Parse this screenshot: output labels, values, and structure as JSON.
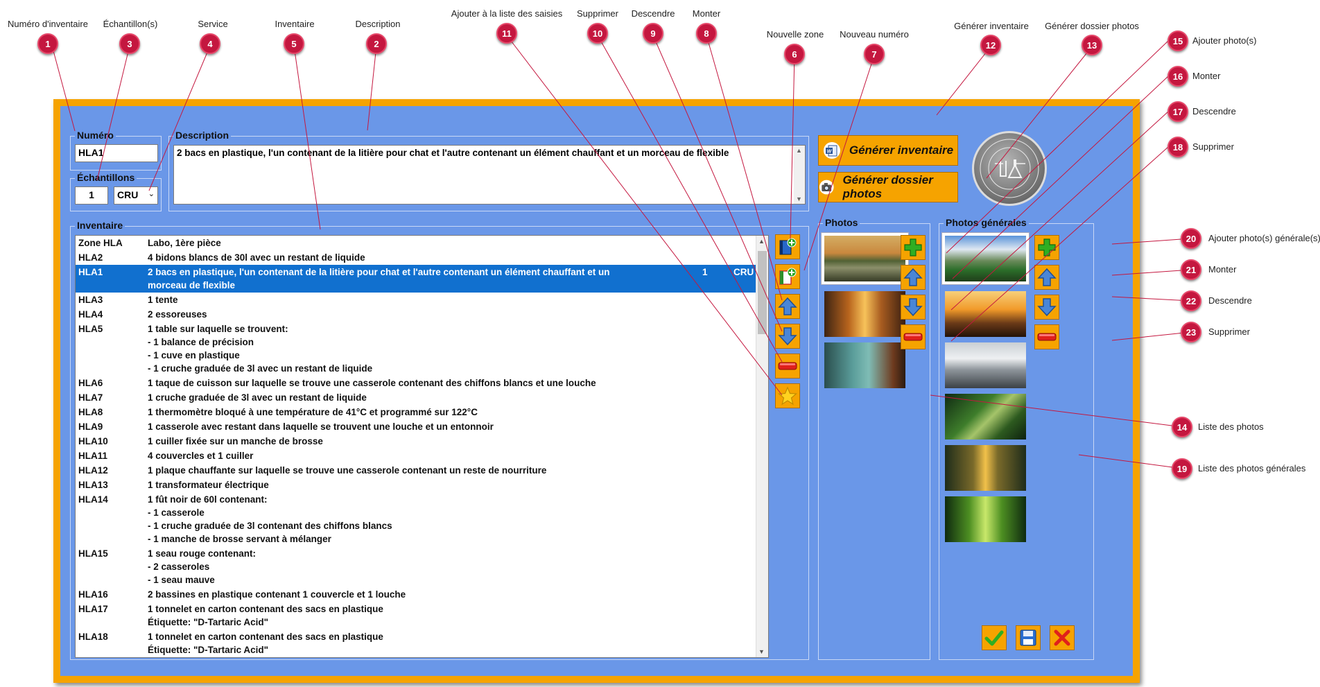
{
  "callouts": [
    {
      "n": "1",
      "label": "Numéro d'inventaire"
    },
    {
      "n": "2",
      "label": "Description"
    },
    {
      "n": "3",
      "label": "Échantillon(s)"
    },
    {
      "n": "4",
      "label": "Service"
    },
    {
      "n": "5",
      "label": "Inventaire"
    },
    {
      "n": "6",
      "label": "Nouvelle zone"
    },
    {
      "n": "7",
      "label": "Nouveau numéro"
    },
    {
      "n": "8",
      "label": "Monter"
    },
    {
      "n": "9",
      "label": "Descendre"
    },
    {
      "n": "10",
      "label": "Supprimer"
    },
    {
      "n": "11",
      "label": "Ajouter à la liste des saisies"
    },
    {
      "n": "12",
      "label": "Générer inventaire"
    },
    {
      "n": "13",
      "label": "Générer dossier photos"
    },
    {
      "n": "14",
      "label": "Liste des photos"
    },
    {
      "n": "15",
      "label": "Ajouter photo(s)"
    },
    {
      "n": "16",
      "label": "Monter"
    },
    {
      "n": "17",
      "label": "Descendre"
    },
    {
      "n": "18",
      "label": "Supprimer"
    },
    {
      "n": "19",
      "label": "Liste des photos générales"
    },
    {
      "n": "20",
      "label": "Ajouter photo(s) générale(s)"
    },
    {
      "n": "21",
      "label": "Monter"
    },
    {
      "n": "22",
      "label": "Descendre"
    },
    {
      "n": "23",
      "label": "Supprimer"
    }
  ],
  "form": {
    "numero_title": "Numéro",
    "numero_value": "HLA1",
    "echantillons_title": "Échantillons",
    "echantillons_qty": "1",
    "service_value": "CRU",
    "description_title": "Description",
    "description_value": "2 bacs en plastique, l'un contenant de la litière pour chat et l'autre contenant un élément chauffant et un morceau de flexible",
    "inventaire_title": "Inventaire",
    "photos_title": "Photos",
    "photos_generales_title": "Photos générales"
  },
  "buttons": {
    "generer_inventaire": "Générer inventaire",
    "generer_dossier_photos": "Générer dossier photos"
  },
  "inventory_rows": [
    {
      "code": "Zone HLA",
      "lines": [
        "Labo, 1ère pièce"
      ],
      "qty": "",
      "svc": ""
    },
    {
      "code": "HLA2",
      "lines": [
        "4 bidons blancs de 30l avec un restant de liquide"
      ],
      "qty": "",
      "svc": ""
    },
    {
      "code": "HLA1",
      "lines": [
        "2 bacs en plastique, l'un contenant de la litière pour chat et l'autre contenant un élément chauffant et un",
        "morceau de flexible"
      ],
      "qty": "1",
      "svc": "CRU",
      "selected": true
    },
    {
      "code": "HLA3",
      "lines": [
        "1 tente"
      ],
      "qty": "",
      "svc": ""
    },
    {
      "code": "HLA4",
      "lines": [
        "2 essoreuses"
      ],
      "qty": "",
      "svc": ""
    },
    {
      "code": "HLA5",
      "lines": [
        "1 table sur laquelle se trouvent:",
        "- 1 balance de précision",
        "- 1 cuve en plastique",
        "- 1 cruche graduée de 3l avec un restant de liquide"
      ],
      "qty": "",
      "svc": ""
    },
    {
      "code": "HLA6",
      "lines": [
        "1 taque de cuisson sur laquelle se trouve une casserole contenant des chiffons blancs et une louche"
      ],
      "qty": "",
      "svc": ""
    },
    {
      "code": "HLA7",
      "lines": [
        "1 cruche graduée de 3l avec un restant de liquide"
      ],
      "qty": "",
      "svc": ""
    },
    {
      "code": "HLA8",
      "lines": [
        "1 thermomètre bloqué à une température de 41°C et programmé sur 122°C"
      ],
      "qty": "",
      "svc": ""
    },
    {
      "code": "HLA9",
      "lines": [
        "1 casserole avec restant dans laquelle se trouvent une louche et un entonnoir"
      ],
      "qty": "",
      "svc": ""
    },
    {
      "code": "HLA10",
      "lines": [
        "1 cuiller fixée sur un manche de brosse"
      ],
      "qty": "",
      "svc": ""
    },
    {
      "code": "HLA11",
      "lines": [
        "4 couvercles et 1 cuiller"
      ],
      "qty": "",
      "svc": ""
    },
    {
      "code": "HLA12",
      "lines": [
        "1 plaque chauffante sur laquelle se trouve une casserole contenant un reste de nourriture"
      ],
      "qty": "",
      "svc": ""
    },
    {
      "code": "HLA13",
      "lines": [
        "1 transformateur électrique"
      ],
      "qty": "",
      "svc": ""
    },
    {
      "code": "HLA14",
      "lines": [
        "1 fût noir de 60l contenant:",
        "- 1 casserole",
        "- 1 cruche graduée de 3l contenant des chiffons blancs",
        "- 1 manche de brosse servant à mélanger"
      ],
      "qty": "",
      "svc": ""
    },
    {
      "code": "HLA15",
      "lines": [
        "1 seau rouge contenant:",
        "- 2 casseroles",
        "- 1 seau mauve"
      ],
      "qty": "",
      "svc": ""
    },
    {
      "code": "HLA16",
      "lines": [
        "2 bassines en plastique contenant 1 couvercle et 1 louche"
      ],
      "qty": "",
      "svc": ""
    },
    {
      "code": "HLA17",
      "lines": [
        "1 tonnelet en carton contenant des sacs en plastique",
        "Étiquette: \"D-Tartaric Acid\""
      ],
      "qty": "",
      "svc": ""
    },
    {
      "code": "HLA18",
      "lines": [
        "1 tonnelet en carton contenant des sacs en plastique",
        "Étiquette: \"D-Tartaric Acid\""
      ],
      "qty": "",
      "svc": ""
    }
  ],
  "icons": {
    "nouvelle_zone": "new-zone-icon",
    "nouveau_numero": "new-number-icon",
    "monter": "arrow-up-icon",
    "descendre": "arrow-down-icon",
    "supprimer": "delete-icon",
    "ajouter_saisie": "star-icon",
    "ajouter_photo": "plus-icon",
    "valider": "check-icon",
    "enregistrer": "save-icon",
    "annuler": "cancel-icon"
  },
  "colors": {
    "window_border": "#f6a300",
    "panel": "#6a97e8",
    "selection": "#1170cf",
    "callout": "#c4173f"
  }
}
